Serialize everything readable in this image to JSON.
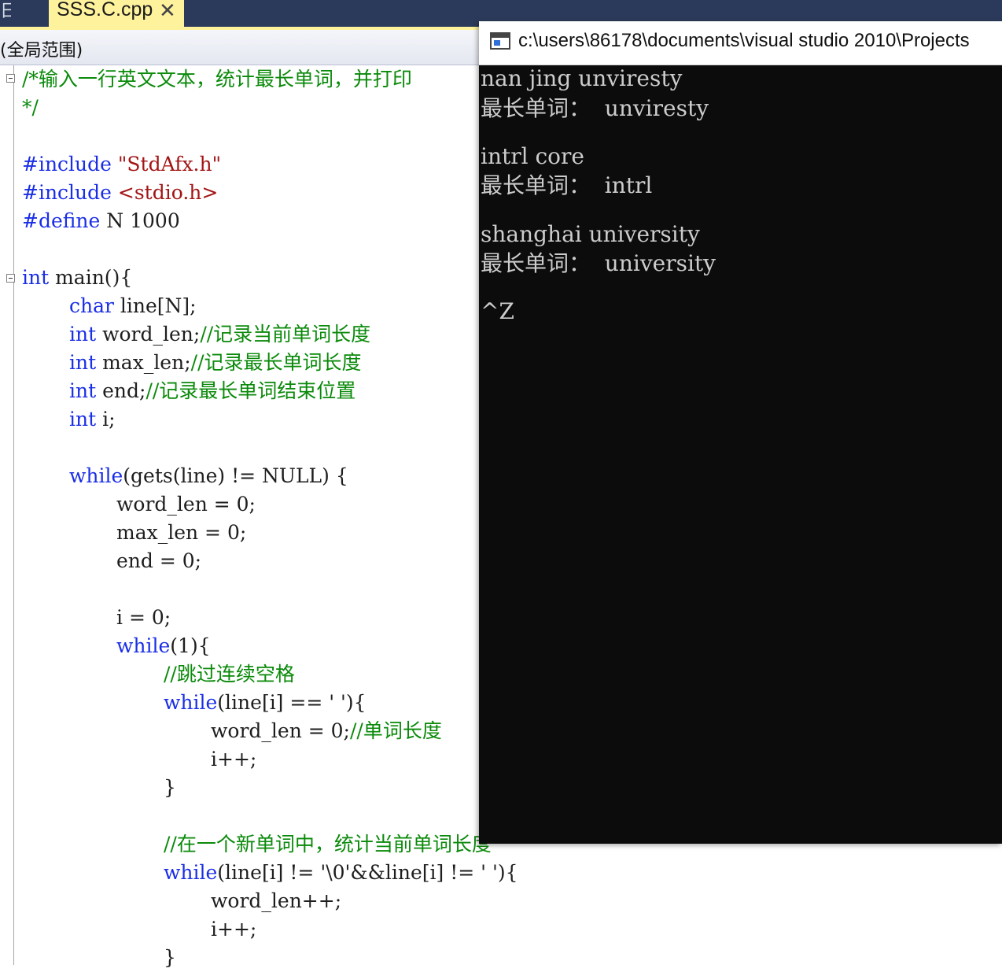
{
  "tabbar": {
    "left_stub": "日",
    "active_tab": "SSS.C.cpp",
    "close_glyph": "✕"
  },
  "scope": {
    "label": "(全局范围)"
  },
  "code": {
    "l1_comment": "/*输入一行英文文本，统计最长单词，并打印",
    "l2_comment": "*/",
    "l3_inc": "#include",
    "l3_str": "\"StdAfx.h\"",
    "l4_inc": "#include",
    "l4_str": "<stdio.h>",
    "l5_def": "#define",
    "l5_rest": " N 1000",
    "l6_kw": "int",
    "l6_rest": " main(){",
    "l7_kw": "char",
    "l7_rest": " line[N];",
    "l8_kw": "int",
    "l8_rest": " word_len;",
    "l8_cm": "//记录当前单词长度",
    "l9_kw": "int",
    "l9_rest": " max_len;",
    "l9_cm": "//记录最长单词长度",
    "l10_kw": "int",
    "l10_rest": " end;",
    "l10_cm": "//记录最长单词结束位置",
    "l11_kw": "int",
    "l11_rest": " i;",
    "l12_kw": "while",
    "l12_rest": "(gets(line) != NULL) {",
    "l13": "word_len = 0;",
    "l14": "max_len = 0;",
    "l15": "end = 0;",
    "l16": "i = 0;",
    "l17_kw": "while",
    "l17_rest": "(1){",
    "l18_cm": "//跳过连续空格",
    "l19_kw": "while",
    "l19_rest": "(line[i] == ' '){",
    "l20_rest": "word_len = 0;",
    "l20_cm": "//单词长度",
    "l21": "i++;",
    "l22": "}",
    "l23_cm": "//在一个新单词中，统计当前单词长度",
    "l24_kw": "while",
    "l24_rest": "(line[i] != '\\0'&&line[i] != ' '){",
    "l25": "word_len++;",
    "l26": "i++;",
    "l27": "}"
  },
  "console": {
    "title": "c:\\users\\86178\\documents\\visual studio 2010\\Projects",
    "lines": [
      "nan jing unviresty",
      "最长单词：  unviresty",
      "intrl core",
      "最长单词：  intrl",
      "shanghai university",
      "最长单词：  university",
      "^Z"
    ]
  },
  "colors": {
    "keyword": "#1a2ee6",
    "comment": "#0a8a0a",
    "string": "#a31515",
    "tab_active": "#fff29d",
    "tabbar_bg": "#2b3a5a",
    "console_bg": "#0c0c0c",
    "console_text": "#cccccc"
  }
}
